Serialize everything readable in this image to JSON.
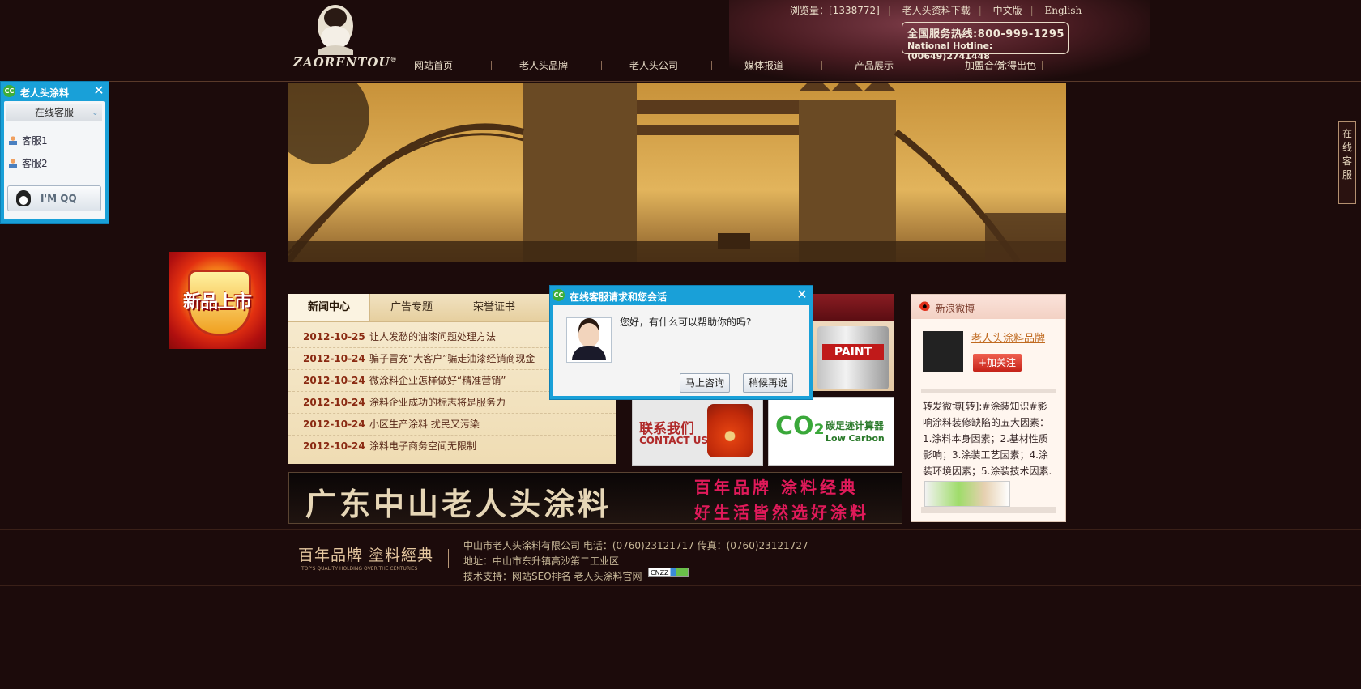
{
  "header": {
    "logo_text": "ZAORENTOU",
    "logo_mark": "®",
    "visits_label": "浏览量：[1338772]",
    "download_link": "老人头资料下载",
    "chinese_link": "中文版",
    "english_link": "English",
    "hotline_line1": "全国服务热线:800-999-1295",
    "hotline_line2": "National Hotline:(00649)2741448"
  },
  "nav": {
    "items": [
      {
        "label": "网站首页"
      },
      {
        "label": "老人头品牌"
      },
      {
        "label": "老人头公司"
      },
      {
        "label": "媒体报道"
      },
      {
        "label": "产品展示"
      },
      {
        "label": "加盟合作"
      },
      {
        "label": "涂得出色"
      }
    ]
  },
  "qq_panel": {
    "title": "老人头涂料",
    "icon_text": "CC",
    "close": "✕",
    "subtitle": "在线客服",
    "items": [
      {
        "label": "客服1"
      },
      {
        "label": "客服2"
      }
    ],
    "qq_button": "I'M QQ"
  },
  "service_tab": {
    "label": "在线客服"
  },
  "new_badge": {
    "text": "新品上市"
  },
  "news": {
    "tabs": [
      {
        "label": "新闻中心"
      },
      {
        "label": "广告专题"
      },
      {
        "label": "荣誉证书"
      }
    ],
    "rows": [
      {
        "date": "2012-10-25",
        "title": "让人发愁的油漆问题处理方法"
      },
      {
        "date": "2012-10-24",
        "title": "骗子冒充“大客户”骗走油漆经销商现金"
      },
      {
        "date": "2012-10-24",
        "title": "微涂料企业怎样做好“精准营销”"
      },
      {
        "date": "2012-10-24",
        "title": "涂料企业成功的标志将是服务力"
      },
      {
        "date": "2012-10-24",
        "title": "小区生产涂料  扰民又污染"
      },
      {
        "date": "2012-10-24",
        "title": "涂料电子商务空间无限制"
      }
    ]
  },
  "product": {
    "can_label": "PAINT"
  },
  "contact_banner": {
    "title": "联系我们",
    "subtitle": "CONTACT US"
  },
  "co2_banner": {
    "co2": "CO₂",
    "title": "碳足迹计算器",
    "subtitle": "Low Carbon"
  },
  "weibo": {
    "header": "新浪微博",
    "name": "老人头涂料品牌",
    "follow": "+加关注",
    "post": "转发微博[转]:#涂装知识#影响涂料装修缺陷的五大因素：1.涂料本身因素；2.基材性质影响；3.涂装工艺因素；4.涂装环境因素；5.涂装技术因素."
  },
  "big_banner": {
    "title": "广东中山老人头涂料",
    "slogan1": "百年品牌  涂料经典",
    "slogan2": "好生活皆然选好涂料"
  },
  "footer": {
    "slogan": "百年品牌 塗料經典",
    "slogan_en": "TOP'S QUALITY HOLDING OVER THE CENTURIES",
    "line1": "中山市老人头涂料有限公司  电话：(0760)23121717    传真：(0760)23121727",
    "line2": "地址：中山市东升镇高沙第二工业区",
    "line3": "技术支持：网站SEO排名  老人头涂料官网",
    "cnzz": "CNZZ"
  },
  "chat_popup": {
    "title": "在线客服请求和您会话",
    "icon_text": "CC",
    "close": "✕",
    "message": "您好，有什么可以帮助你的吗?",
    "consult_button": "马上咨询",
    "later_button": "稍候再说"
  },
  "colors": {
    "background": "#1c0b0b",
    "qq_blue": "#19a0d8",
    "news_date": "#8a2a12",
    "follow_red": "#c52218"
  }
}
